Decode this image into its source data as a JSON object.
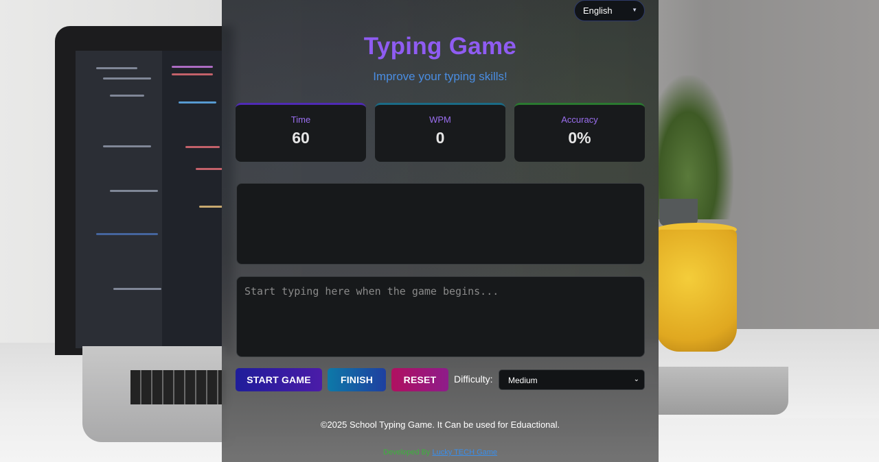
{
  "header": {
    "language_selected": "English",
    "title": "Typing Game",
    "subtitle": "Improve your typing skills!"
  },
  "stats": {
    "time": {
      "label": "Time",
      "value": "60"
    },
    "wpm": {
      "label": "WPM",
      "value": "0"
    },
    "accuracy": {
      "label": "Accuracy",
      "value": "0%"
    }
  },
  "game": {
    "text_display": "",
    "input_placeholder": "Start typing here when the game begins...",
    "input_value": ""
  },
  "controls": {
    "start_label": "START GAME",
    "finish_label": "FINISH",
    "reset_label": "RESET",
    "difficulty_label": "Difficulty:",
    "difficulty_selected": "Medium"
  },
  "footer": {
    "copyright": "©2025 School Typing Game. It Can be used for Eduactional.",
    "credit_prefix": "Developed By",
    "credit_link": "Lucky TECH Game"
  },
  "colors": {
    "title": "#8f5cf2",
    "subtitle": "#4a8de2",
    "stat_label": "#9b6ff0",
    "time_accent": "#4f2ab5",
    "wpm_accent": "#1a6b86",
    "accuracy_accent": "#2a7a30",
    "start_button": "#1f1d9a",
    "finish_button": "#0d79a8",
    "reset_button": "#b01060"
  }
}
